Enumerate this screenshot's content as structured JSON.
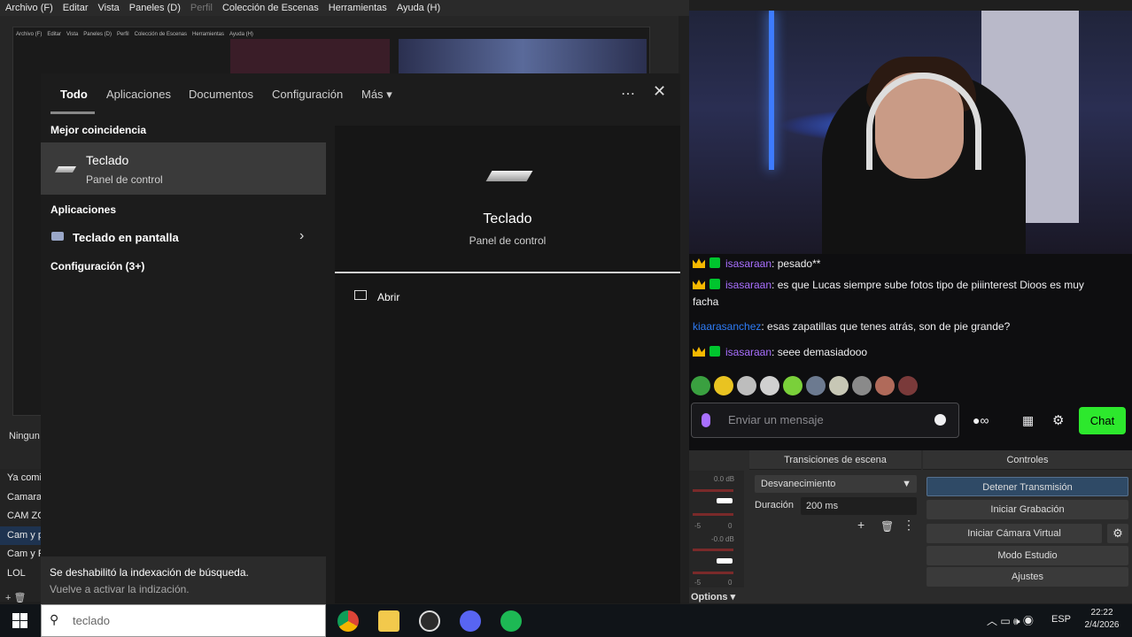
{
  "obs": {
    "menu": [
      "Archivo (F)",
      "Editar",
      "Vista",
      "Paneles (D)",
      "Perfil",
      "Colección de Escenas",
      "Herramientas",
      "Ayuda (H)"
    ],
    "nested_menu": [
      "Archivo (F)",
      "Editar",
      "Vista",
      "Paneles (D)",
      "Perfil",
      "Colección de Escenas",
      "Herramientas",
      "Ayuda (H)"
    ],
    "scenes_label": "Ningun",
    "scenes": [
      "Ya comi",
      "Camara",
      "CAM ZC",
      "Cam y p",
      "Cam y F",
      "LOL"
    ],
    "selected_scene_index": 3,
    "transitions_header": "Transiciones de escena",
    "controls_header": "Controles",
    "transition": "Desvanecimiento",
    "duration_label": "Duración",
    "duration_value": "200 ms",
    "mixer": {
      "db1": "0.0 dB",
      "db2": "-0.0 dB",
      "tick_a": "-5",
      "tick_b": "0"
    },
    "options": "Options",
    "controls": [
      "Detener Transmisión",
      "Iniciar Grabación",
      "Iniciar Cámara Virtual",
      "Modo Estudio",
      "Ajustes"
    ]
  },
  "chat": {
    "messages": [
      {
        "badges": [
          "crown-icon",
          "sub-badge-icon"
        ],
        "user": "isasaraan",
        "text": ": pesado**",
        "color": "#a970ff"
      },
      {
        "badges": [
          "crown-icon",
          "sub-badge-icon"
        ],
        "user": "isasaraan",
        "text": ": es que Lucas siempre sube fotos tipo de piiinterest Dioos es muy facha",
        "color": "#a970ff"
      },
      {
        "badges": [],
        "user": "kiaarasanchez",
        "text": ": esas zapatillas que tenes atrás, son de pie grande?",
        "color": "#2e7cf6"
      },
      {
        "badges": [
          "crown-icon",
          "sub-badge-icon"
        ],
        "user": "isasaraan",
        "text": ": seee demasiadooo",
        "color": "#a970ff"
      }
    ],
    "input_placeholder": "Enviar un mensaje",
    "chat_button": "Chat",
    "brand_green": "#2de82d"
  },
  "search": {
    "tabs": [
      "Todo",
      "Aplicaciones",
      "Documentos",
      "Configuración",
      "Más"
    ],
    "active_tab": "Todo",
    "best_match_header": "Mejor coincidencia",
    "best_match": {
      "title": "Teclado",
      "subtitle": "Panel de control",
      "icon": "keyboard-icon"
    },
    "apps_header": "Aplicaciones",
    "app_item": "Teclado en pantalla",
    "settings_header": "Configuración (3+)",
    "preview": {
      "title": "Teclado",
      "subtitle": "Panel de control",
      "open": "Abrir"
    },
    "note_title": "Se deshabilitó la indexación de búsqueda.",
    "note_sub": "Vuelve a activar la indización.",
    "query": "teclado"
  },
  "taskbar": {
    "apps": [
      "chrome-icon",
      "file-explorer-icon",
      "obs-icon",
      "discord-icon",
      "spotify-icon"
    ],
    "lang": "ESP",
    "time": "22:22",
    "date": "2/4/2026"
  }
}
